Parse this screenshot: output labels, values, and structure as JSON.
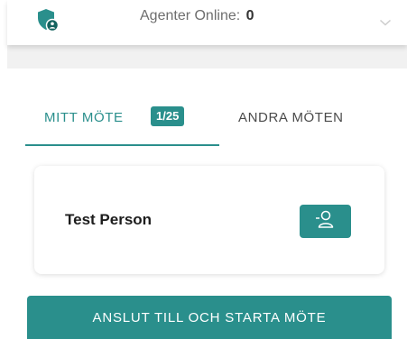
{
  "header": {
    "agent_label": "Agenter Online:",
    "agent_count": "0",
    "icon": "shield-user-icon",
    "dropdown_icon": "chevron-down-icon"
  },
  "tabs": [
    {
      "label": "MITT MÖTE",
      "badge": "1/25",
      "active": true
    },
    {
      "label": "ANDRA MÖTEN",
      "active": false
    }
  ],
  "card": {
    "person_name": "Test Person",
    "action_icon": "person-icon"
  },
  "actions": {
    "join_label": "ANSLUT TILL OCH STARTA MÖTE"
  },
  "colors": {
    "accent": "#2a8f8c",
    "accent_dark": "#14635f",
    "dropdown_gray": "#cccccc"
  }
}
